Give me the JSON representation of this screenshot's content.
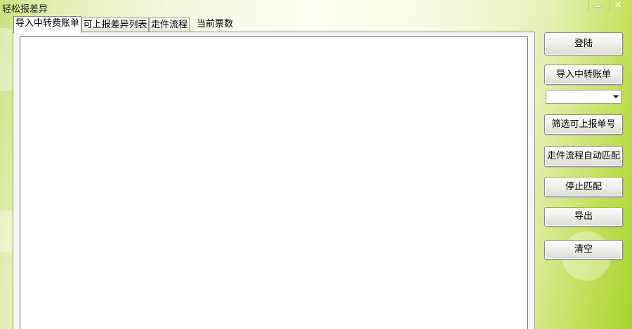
{
  "window": {
    "title": "轻松报差异",
    "minimize_glyph": "–",
    "close_glyph": "✕"
  },
  "tabs": [
    {
      "label": "导入中转费账单",
      "active": true
    },
    {
      "label": "可上报差异列表",
      "active": false
    },
    {
      "label": "走件流程",
      "active": false
    },
    {
      "label": "当前票数",
      "active": false
    }
  ],
  "buttons": {
    "login": "登陆",
    "import_bill": "导入中转账单",
    "filter_numbers": "筛选可上报单号",
    "auto_match": "走件流程自动匹配",
    "stop_match": "停止匹配",
    "export": "导出",
    "clear": "清空"
  },
  "dropdown": {
    "value": ""
  },
  "colors": {
    "theme_green": "#a9d230",
    "button_face": "#f0f0ec",
    "content_bg": "#ffffff"
  }
}
